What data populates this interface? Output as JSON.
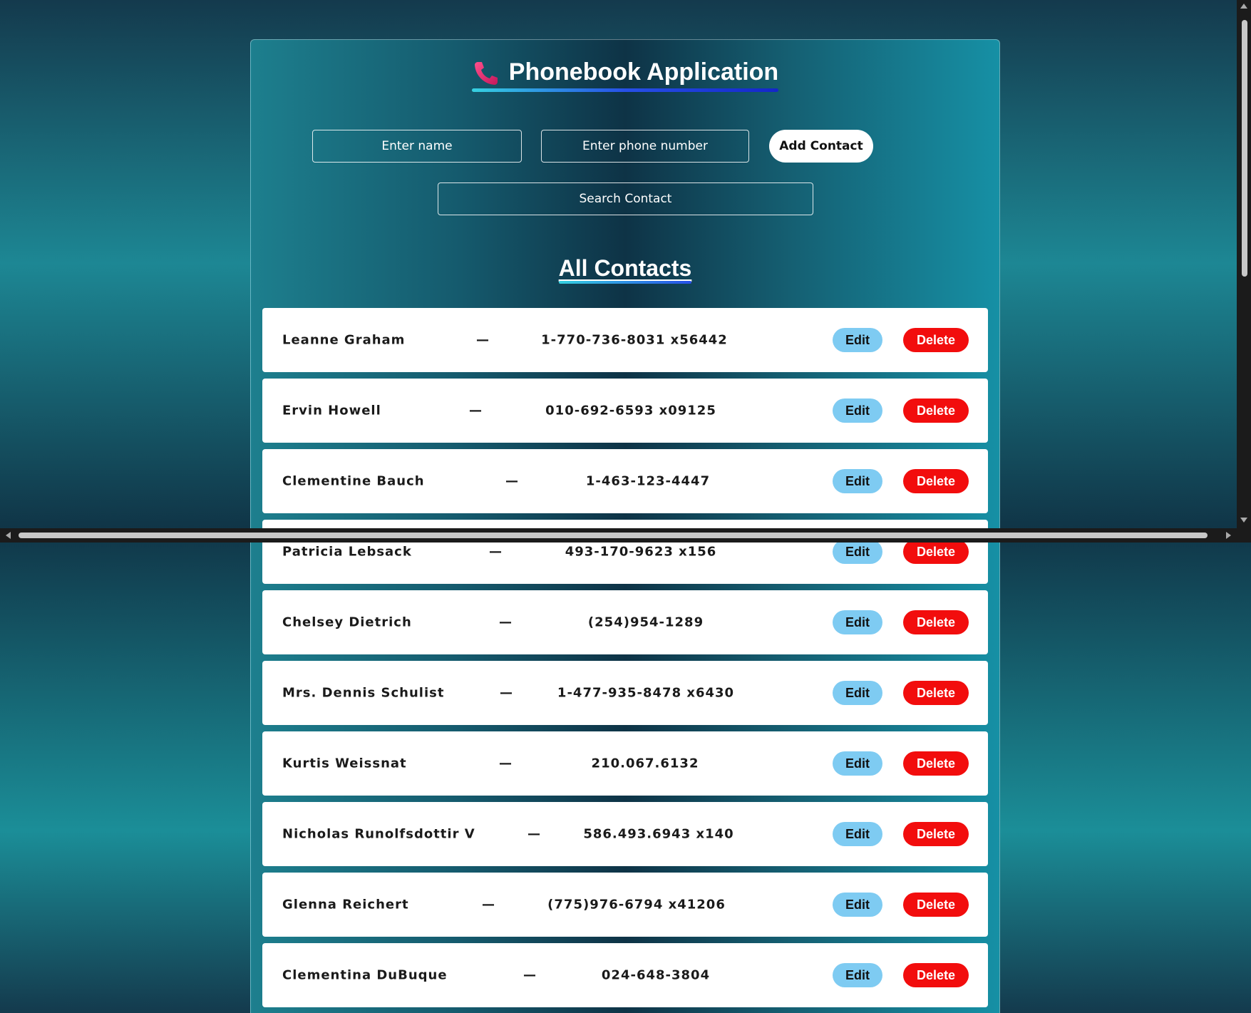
{
  "header": {
    "title": "Phonebook Application",
    "icon": "phone-icon"
  },
  "form": {
    "name_placeholder": "Enter name",
    "name_value": "",
    "phone_placeholder": "Enter phone number",
    "phone_value": "",
    "add_label": "Add Contact"
  },
  "search": {
    "placeholder": "Search Contact",
    "value": ""
  },
  "list": {
    "title": "All Contacts",
    "separator": "—",
    "edit_label": "Edit",
    "delete_label": "Delete",
    "contacts": [
      {
        "name": "Leanne Graham",
        "phone": "1-770-736-8031 x56442"
      },
      {
        "name": "Ervin Howell",
        "phone": "010-692-6593 x09125"
      },
      {
        "name": "Clementine Bauch",
        "phone": "1-463-123-4447"
      },
      {
        "name": "Patricia Lebsack",
        "phone": "493-170-9623 x156"
      },
      {
        "name": "Chelsey Dietrich",
        "phone": "(254)954-1289"
      },
      {
        "name": "Mrs. Dennis Schulist",
        "phone": "1-477-935-8478 x6430"
      },
      {
        "name": "Kurtis Weissnat",
        "phone": "210.067.6132"
      },
      {
        "name": "Nicholas Runolfsdottir V",
        "phone": "586.493.6943 x140"
      },
      {
        "name": "Glenna Reichert",
        "phone": "(775)976-6794 x41206"
      },
      {
        "name": "Clementina DuBuque",
        "phone": "024-648-3804"
      }
    ]
  },
  "colors": {
    "accent_edit": "#7ecbf2",
    "accent_delete": "#f20d0d"
  }
}
